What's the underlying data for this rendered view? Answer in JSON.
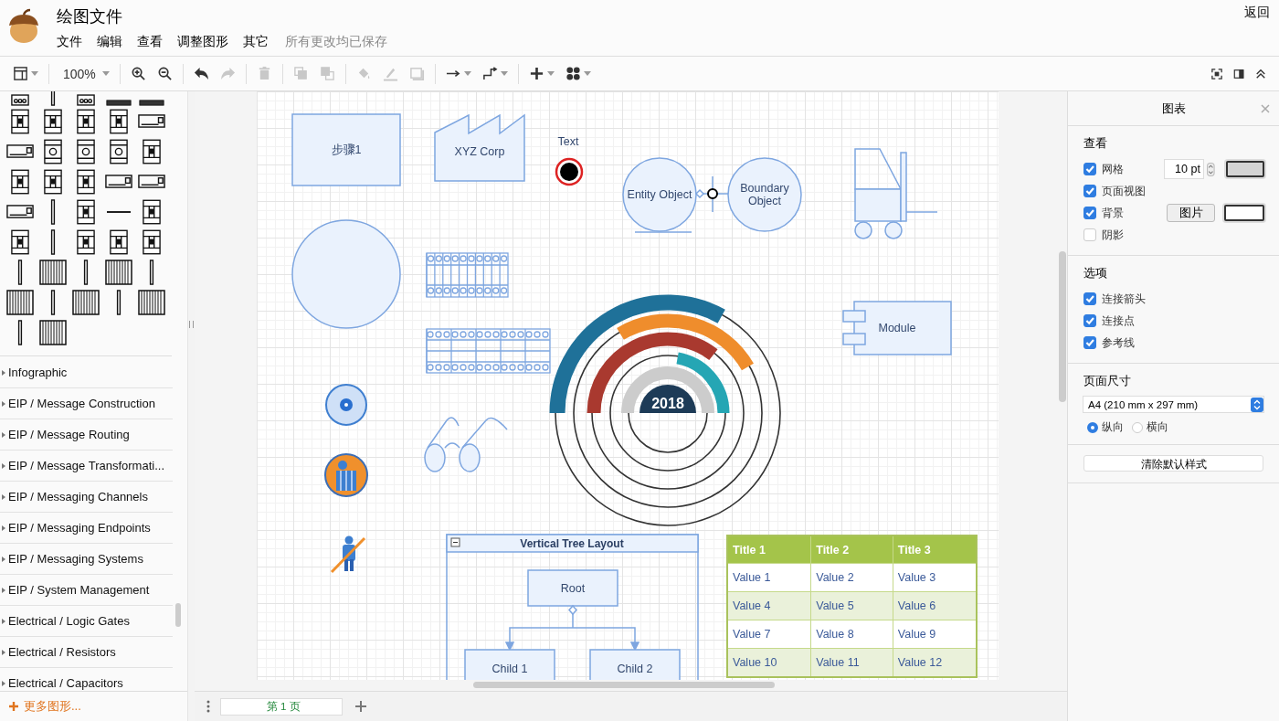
{
  "header": {
    "title": "绘图文件",
    "menu": [
      "文件",
      "编辑",
      "查看",
      "调整图形",
      "其它"
    ],
    "save_status": "所有更改均已保存",
    "back": "返回"
  },
  "toolbar": {
    "groups": [
      [
        {
          "kind": "layout",
          "dropdown": true,
          "disabled": false
        }
      ],
      [
        {
          "kind": "zoom",
          "label": "100%",
          "dropdown": true,
          "disabled": false
        }
      ],
      [
        {
          "kind": "zoom-in",
          "dropdown": false,
          "disabled": false
        },
        {
          "kind": "zoom-out",
          "dropdown": false,
          "disabled": false
        }
      ],
      [
        {
          "kind": "undo",
          "dropdown": false,
          "disabled": false
        },
        {
          "kind": "redo",
          "dropdown": false,
          "disabled": true
        }
      ],
      [
        {
          "kind": "delete",
          "dropdown": false,
          "disabled": true
        }
      ],
      [
        {
          "kind": "to-front",
          "dropdown": false,
          "disabled": true
        },
        {
          "kind": "to-back",
          "dropdown": false,
          "disabled": true
        }
      ],
      [
        {
          "kind": "fill",
          "dropdown": false,
          "disabled": true
        },
        {
          "kind": "line",
          "dropdown": false,
          "disabled": true
        },
        {
          "kind": "shadow",
          "dropdown": false,
          "disabled": true
        }
      ],
      [
        {
          "kind": "connector",
          "dropdown": true,
          "disabled": false
        },
        {
          "kind": "waypoint",
          "dropdown": true,
          "disabled": false
        }
      ],
      [
        {
          "kind": "insert",
          "dropdown": true,
          "disabled": false
        },
        {
          "kind": "shapes",
          "dropdown": true,
          "disabled": false
        }
      ]
    ],
    "right": [
      {
        "kind": "fullscreen",
        "dropdown": false,
        "disabled": false
      },
      {
        "kind": "panel",
        "dropdown": false,
        "disabled": false
      },
      {
        "kind": "collapse",
        "dropdown": false,
        "disabled": false
      }
    ]
  },
  "sidebar": {
    "categories": [
      {
        "label": "Infographic",
        "expanded": false
      },
      {
        "label": "EIP / Message Construction",
        "expanded": false
      },
      {
        "label": "EIP / Message Routing",
        "expanded": false
      },
      {
        "label": "EIP / Message Transformati...",
        "expanded": false
      },
      {
        "label": "EIP / Messaging Channels",
        "expanded": false
      },
      {
        "label": "EIP / Messaging Endpoints",
        "expanded": false
      },
      {
        "label": "EIP / Messaging Systems",
        "expanded": false
      },
      {
        "label": "EIP / System Management",
        "expanded": false
      },
      {
        "label": "Electrical / Logic Gates",
        "expanded": false
      },
      {
        "label": "Electrical / Resistors",
        "expanded": false
      },
      {
        "label": "Electrical / Capacitors",
        "expanded": false
      }
    ],
    "more_shapes": "更多图形..."
  },
  "canvas": {
    "step": "步骤1",
    "factory": "XYZ Corp",
    "text": "Text",
    "entity": "Entity Object",
    "boundary": "Boundary Object",
    "module": "Module",
    "year": "2018",
    "tree": {
      "title": "Vertical Tree Layout",
      "root": "Root",
      "children": [
        "Child 1",
        "Child 2"
      ]
    },
    "table": {
      "columns": [
        "Title 1",
        "Title 2",
        "Title 3"
      ],
      "rows": [
        [
          "Value 1",
          "Value 2",
          "Value 3"
        ],
        [
          "Value 4",
          "Value 5",
          "Value 6"
        ],
        [
          "Value 7",
          "Value 8",
          "Value 9"
        ],
        [
          "Value 10",
          "Value 11",
          "Value 12"
        ]
      ]
    }
  },
  "pages": [
    {
      "label": "第 1 页",
      "selected": true
    }
  ],
  "panel": {
    "title": "图表",
    "view": {
      "heading": "查看",
      "options": [
        {
          "label": "网格",
          "checked": true
        },
        {
          "label": "页面视图",
          "checked": true
        },
        {
          "label": "背景",
          "checked": true
        },
        {
          "label": "阴影",
          "checked": false
        }
      ],
      "grid_size": "10 pt",
      "image_button": "图片"
    },
    "options": {
      "heading": "选项",
      "options": [
        {
          "label": "连接箭头",
          "checked": true
        },
        {
          "label": "连接点",
          "checked": true
        },
        {
          "label": "参考线",
          "checked": true
        }
      ]
    },
    "page_size": {
      "heading": "页面尺寸",
      "value": "A4 (210 mm x 297 mm)",
      "orientations": [
        {
          "label": "纵向",
          "selected": true
        },
        {
          "label": "横向",
          "selected": false
        }
      ]
    },
    "reset_button": "清除默认样式"
  }
}
